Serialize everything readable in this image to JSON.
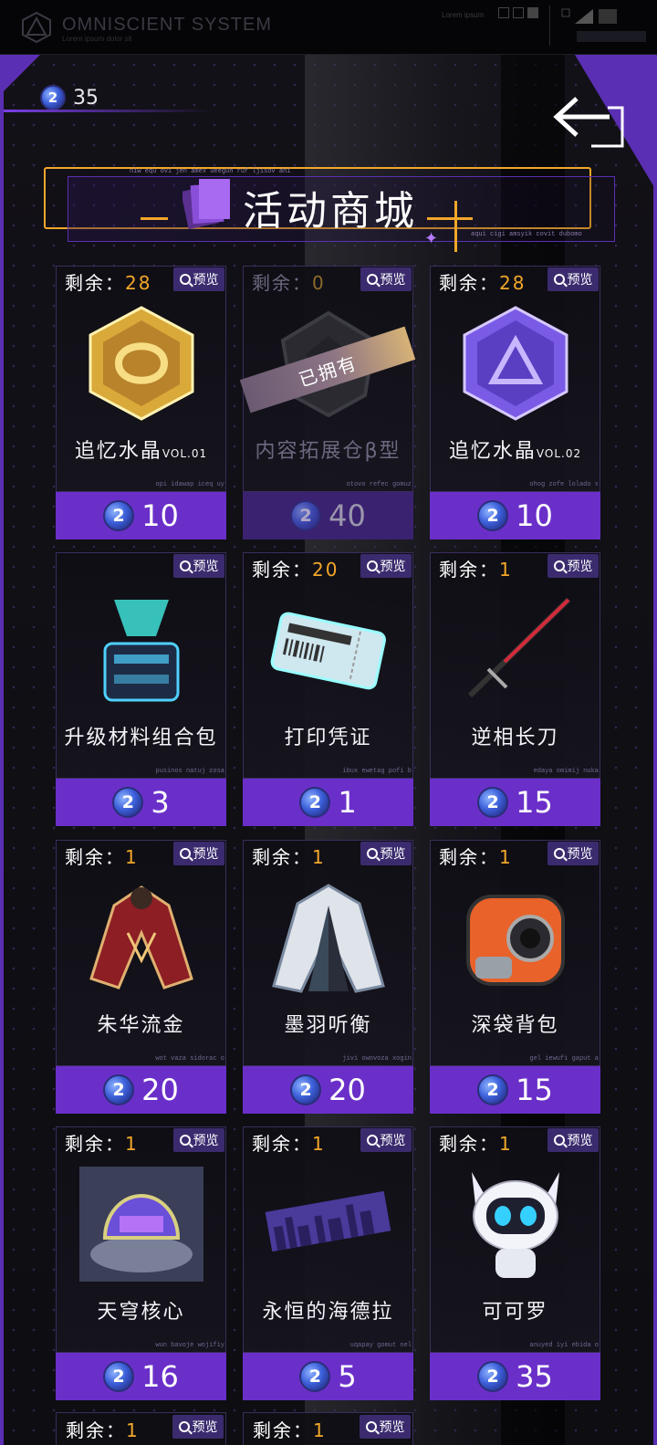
{
  "system_bar": {
    "title": "OMNISCIENT SYSTEM",
    "subtitle": "Lorem ipsum dolor sit",
    "right_text": "Lorem ipsum"
  },
  "currency": {
    "icon": "blue-token-icon",
    "value": "35"
  },
  "banner": {
    "title": "活动商城",
    "top_small": "niw equ ovi jen amex ueeguh ruf ljisov ahi",
    "bottom_small": "aqui cigi amsyik covit dubomo"
  },
  "labels": {
    "remain": "剩余：",
    "preview": "预览",
    "owned": "已拥有"
  },
  "items": [
    {
      "remain": "28",
      "name": "追忆水晶",
      "vol": "VOL.01",
      "price": "10",
      "tiny": "opi idawap iceq uy",
      "icon": "gold-crystal-icon",
      "owned": false
    },
    {
      "remain": "0",
      "name": "内容拓展仓β型",
      "vol": "",
      "price": "40",
      "tiny": "otovo refec gomuz",
      "icon": "storage-badge-icon",
      "owned": true
    },
    {
      "remain": "28",
      "name": "追忆水晶",
      "vol": "VOL.02",
      "price": "10",
      "tiny": "ohog zofe lolado x",
      "icon": "purple-crystal-icon",
      "owned": false
    },
    {
      "remain": "",
      "name": "升级材料组合包",
      "vol": "",
      "price": "3",
      "tiny": "pusinos natuj zosa",
      "icon": "material-pack-icon",
      "owned": false
    },
    {
      "remain": "20",
      "name": "打印凭证",
      "vol": "",
      "price": "1",
      "tiny": "ibux ewetag pofi b",
      "icon": "print-ticket-icon",
      "owned": false
    },
    {
      "remain": "1",
      "name": "逆相长刀",
      "vol": "",
      "price": "15",
      "tiny": "edaya omimij nuka",
      "icon": "long-blade-icon",
      "owned": false
    },
    {
      "remain": "1",
      "name": "朱华流金",
      "vol": "",
      "price": "20",
      "tiny": "wot vaza sidorac o",
      "icon": "red-outfit-icon",
      "owned": false
    },
    {
      "remain": "1",
      "name": "墨羽听衡",
      "vol": "",
      "price": "20",
      "tiny": "jivi owovoza xogin",
      "icon": "white-coat-icon",
      "owned": false
    },
    {
      "remain": "1",
      "name": "深袋背包",
      "vol": "",
      "price": "15",
      "tiny": "gel iewufi gaput a",
      "icon": "orange-backpack-icon",
      "owned": false
    },
    {
      "remain": "1",
      "name": "天穹核心",
      "vol": "",
      "price": "16",
      "tiny": "wun bavoje wojifiy",
      "icon": "dome-core-icon",
      "owned": false
    },
    {
      "remain": "1",
      "name": "永恒的海德拉",
      "vol": "",
      "price": "5",
      "tiny": "uqapay gomut nel",
      "icon": "city-banner-icon",
      "owned": false
    },
    {
      "remain": "1",
      "name": "可可罗",
      "vol": "",
      "price": "35",
      "tiny": "anuyed iyi ebida o",
      "icon": "robot-mascot-icon",
      "owned": false
    }
  ],
  "partial_row": [
    {
      "remain": "1"
    },
    {
      "remain": "1"
    }
  ],
  "colors": {
    "accent": "#6a2fc9",
    "gold": "#f2a72a",
    "border": "#5b2fb3"
  }
}
